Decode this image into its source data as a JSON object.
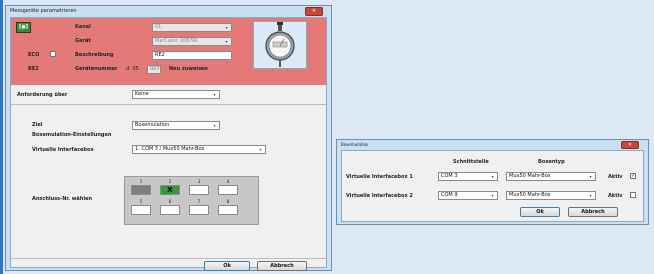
{
  "main_dialog": {
    "title": "Messgeräte parametrieren",
    "close_glyph": "✕",
    "device_icon_text": "[●]",
    "labels": {
      "kanal": "Kanal",
      "geraet": "Gerät",
      "beschreibung": "Beschreibung",
      "geraetenummer": "Gerätenummer",
      "eco": "ECO",
      "re2": "RE2"
    },
    "kanal_value": "01",
    "geraet_value": "MarCator 1087RI",
    "beschreibung_value": "RE2",
    "geraetenummer_prefix": "d: 05",
    "geraetenummer_value": "007",
    "neu_zuweisen": "Neu zuweisen",
    "anforderung_label": "Anforderung über",
    "anforderung_value": "Keine",
    "ziel_label": "Ziel",
    "ziel_value": "Boxemulation",
    "boxemulation_settings_label": "Boxemulation-Einstellungen",
    "virtuelle_label": "Virtuelle Interfacebox",
    "virtuelle_value": "1: COM 3 / Mux50 Mahr-Box",
    "anschluss_label": "Anschluss-Nr. wählen",
    "slots": [
      {
        "num": "1",
        "mark": "",
        "state": "dark"
      },
      {
        "num": "2",
        "mark": "X",
        "state": "sel"
      },
      {
        "num": "3",
        "mark": "",
        "state": "free"
      },
      {
        "num": "4",
        "mark": "",
        "state": "free"
      },
      {
        "num": "5",
        "mark": "",
        "state": "free"
      },
      {
        "num": "6",
        "mark": "",
        "state": "free"
      },
      {
        "num": "7",
        "mark": "",
        "state": "free"
      },
      {
        "num": "8",
        "mark": "",
        "state": "free"
      }
    ],
    "ok_label": "Ok",
    "abbrech_label": "Abbrech"
  },
  "box_dialog": {
    "title": "Boxemulation",
    "col_schnittstelle": "Schnittstelle",
    "col_boxentyp": "Boxentyp",
    "rows": [
      {
        "label": "Virtuelle Interfacebox 1",
        "port": "COM 3",
        "box": "Mux50 Mahr-Box",
        "aktiv_label": "Aktiv",
        "checked": "✓"
      },
      {
        "label": "Virtuelle Interfacebox 2",
        "port": "COM 9",
        "box": "Mux50 Mahr-Box",
        "aktiv_label": "Aktiv",
        "checked": ""
      }
    ],
    "ok_label": "Ok",
    "abbrech_label": "Abbrech"
  },
  "colors": {
    "header_red": "#e37a78",
    "selected_slot": "#2f9a3f",
    "window_frame": "#c9dff2"
  },
  "icons": [
    "device-icon",
    "dial-gauge-icon",
    "dropdown-arrow-icon",
    "close-icon",
    "check-icon"
  ]
}
